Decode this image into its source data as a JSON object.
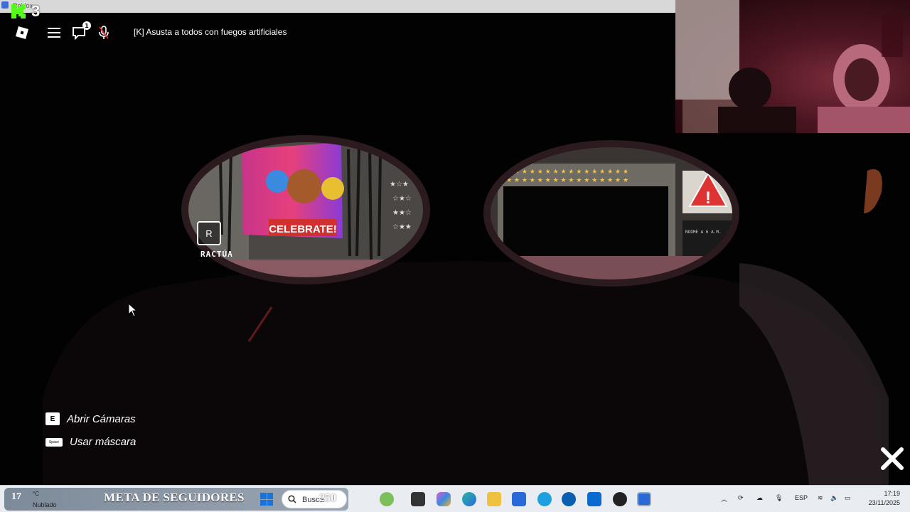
{
  "window": {
    "tiny_title": "Roblox"
  },
  "overlay": {
    "kick_count": "3"
  },
  "topbar": {
    "chat_badge": "1",
    "announcement": "[K] Asusta a todos con fuegos artificiales"
  },
  "scene": {
    "poster_text": "CELEBRATE!",
    "interact_key": "R",
    "interact_label": "RACTÚA",
    "note_text": "NOOME A 6 A.M."
  },
  "controls": {
    "cameras": {
      "key": "E",
      "label": "Abrir Cámaras"
    },
    "mask": {
      "key": "Space",
      "label": "Usar máscara"
    }
  },
  "taskbar": {
    "weather_temp": "17",
    "weather_unit": "°C",
    "weather_desc": "Nublado",
    "meta_text": "META DE SEGUIDORES",
    "search_placeholder": "Busca",
    "overlay_number": "250",
    "language": "ESP",
    "time": "17:19",
    "date": "23/11/2025"
  },
  "colors": {
    "accent": "#1a73d9",
    "kick_green": "#53fc18"
  },
  "icons": [
    "roblox-icon",
    "menu-icon",
    "chat-icon",
    "microphone-icon",
    "close-icon",
    "search-icon",
    "windows-start-icon",
    "wifi-icon",
    "speaker-icon",
    "battery-icon"
  ]
}
